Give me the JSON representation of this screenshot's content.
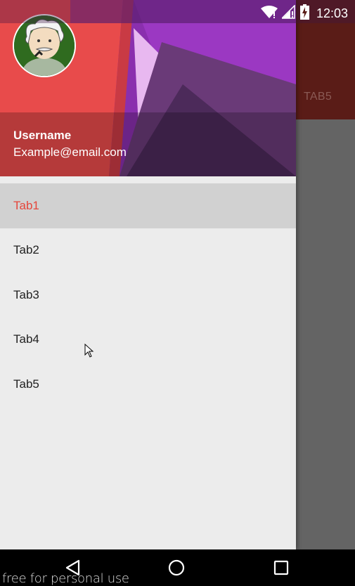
{
  "status_bar": {
    "time": "12:03",
    "icons": [
      "wifi-icon",
      "signal-icon",
      "battery-charging-icon"
    ]
  },
  "drawer": {
    "header": {
      "username": "Username",
      "email": "Example@email.com"
    },
    "items": [
      {
        "label": "Tab1",
        "selected": true
      },
      {
        "label": "Tab2",
        "selected": false
      },
      {
        "label": "Tab3",
        "selected": false
      },
      {
        "label": "Tab4",
        "selected": false
      },
      {
        "label": "Tab5",
        "selected": false
      }
    ]
  },
  "background_app": {
    "tab_label": "TAB5"
  },
  "colors": {
    "accent": "#e5463b",
    "drawer_bg": "#ececec",
    "selected_bg": "#d1d1d1"
  },
  "watermark": "free for personal use"
}
